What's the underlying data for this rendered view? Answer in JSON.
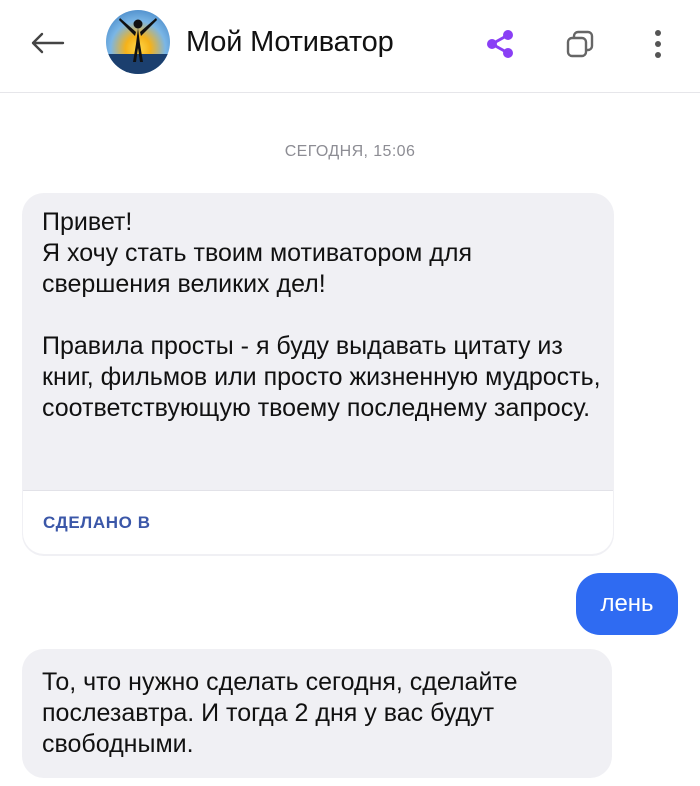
{
  "header": {
    "title": "Мой Мотиватор",
    "accent_color": "#8a3ff5"
  },
  "chat": {
    "timestamp": "СЕГОДНЯ, 15:06",
    "bot_message_1": "Привет!\nЯ хочу стать твоим мотиватором для свершения великих дел!\n\nПравила просты - я буду выдавать цитату из книг, фильмов или просто жизненную мудрость, соответствующую твоему последнему запросу.",
    "made_in_label": "СДЕЛАНО В",
    "user_message": "лень",
    "bot_message_2": "То, что нужно сделать сегодня, сделайте послезавтра. И тогда 2 дня у вас будут свободными.",
    "user_bubble_color": "#2f6bf2"
  },
  "icons": {
    "back": "arrow-left-icon",
    "share": "share-icon",
    "tabs": "tabs-icon",
    "more": "more-vertical-icon"
  }
}
